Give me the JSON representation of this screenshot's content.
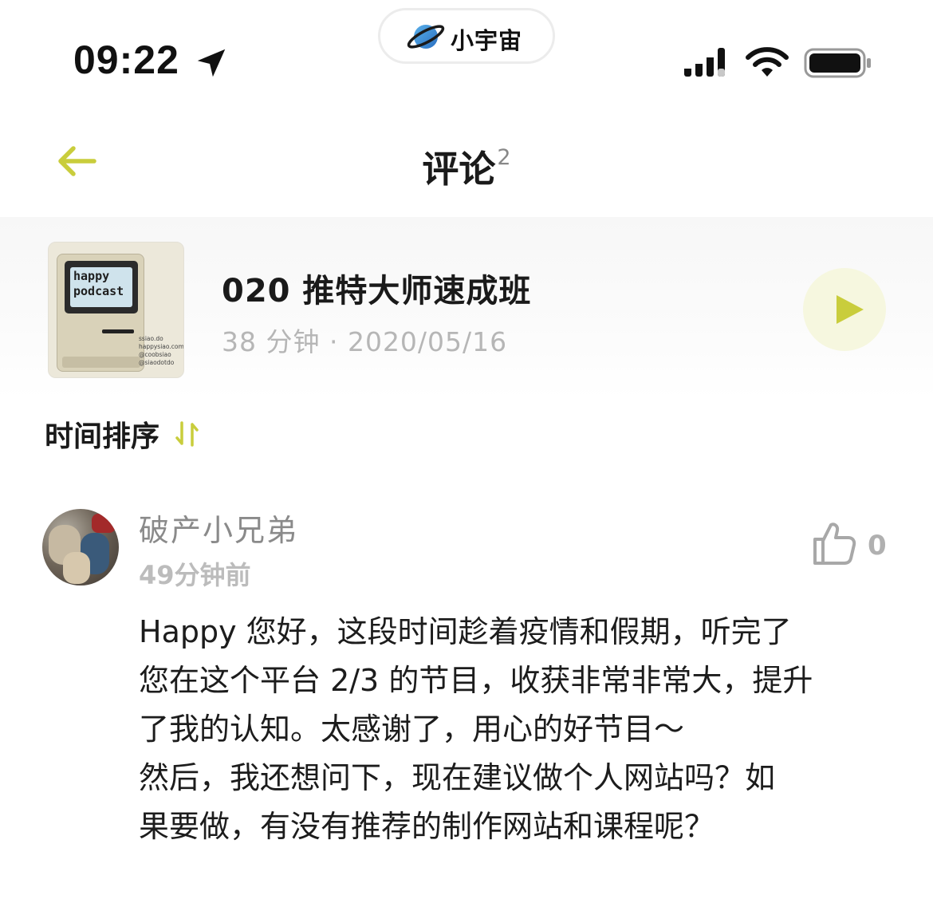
{
  "status_bar": {
    "time": "09:22",
    "app_pill_label": "小宇宙",
    "icons": [
      "location-arrow-icon",
      "planet-icon",
      "cellular-signal-icon",
      "wifi-icon",
      "battery-icon"
    ]
  },
  "nav": {
    "title": "评论",
    "count": "2",
    "back_icon": "back-arrow-icon"
  },
  "episode": {
    "title": "020 推特大师速成班",
    "meta": "38 分钟 · 2020/05/16",
    "cover": {
      "screen_text": "happy\npodcast",
      "side_text": "ssiao.do\nhappysiao.com\n@coobsiao\n@siaodotdo"
    },
    "play_icon": "play-icon"
  },
  "sort": {
    "label": "时间排序",
    "icon": "sort-arrows-icon"
  },
  "comment": {
    "username": "破产小兄弟",
    "time": "49分钟前",
    "likes": "0",
    "like_icon": "thumbs-up-icon",
    "body": "Happy 您好，这段时间趁着疫情和假期，听完了\n您在这个平台 2/3 的节目，收获非常非常大，提升\n了我的认知。太感谢了，用心的好节目～\n然后，我还想问下，现在建议做个人网站吗？如\n果要做，有没有推荐的制作网站和课程呢？"
  },
  "colors": {
    "accent": "#c9cd3c",
    "accent_bg": "#f6f7df",
    "secondary_text": "#8a8a8a",
    "muted_text": "#b6b6b6"
  }
}
